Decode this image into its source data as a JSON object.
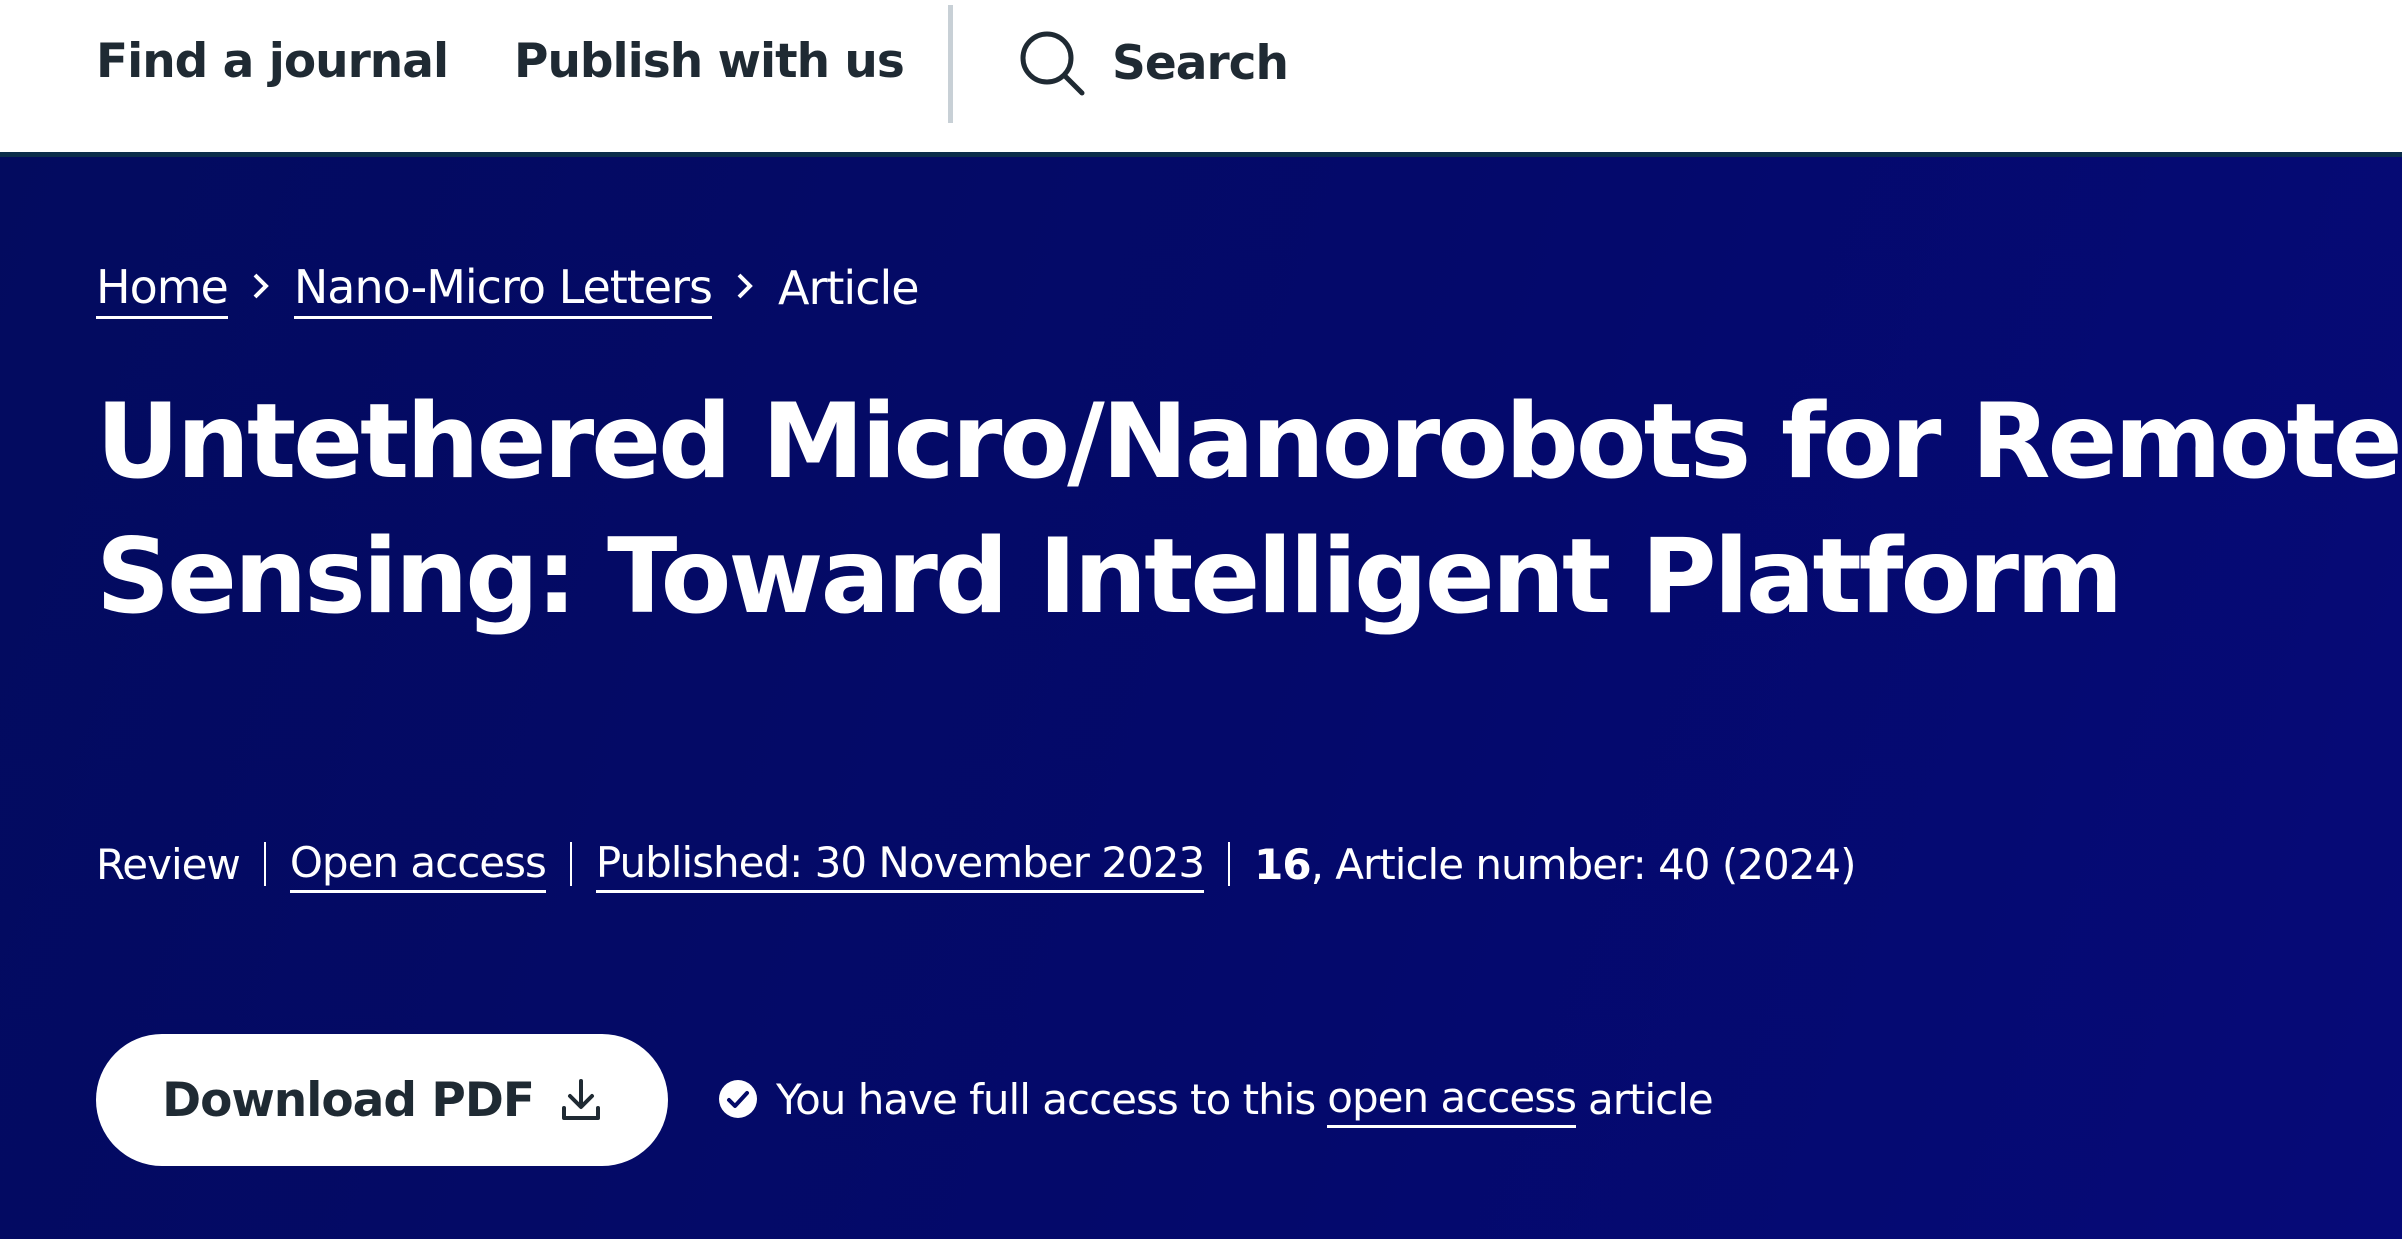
{
  "topnav": {
    "find_journal": "Find a journal",
    "publish": "Publish with us",
    "search": "Search",
    "search_icon": "search-icon"
  },
  "breadcrumb": {
    "items": [
      "Home",
      "Nano-Micro Letters",
      "Article"
    ],
    "separator_icon": "chevron-right-icon"
  },
  "article": {
    "title_line1": "Untethered Micro/Nanorobots for Remote",
    "title_line2": "Sensing: Toward Intelligent Platform",
    "type": "Review",
    "access": "Open access",
    "published": "Published: 30 November 2023",
    "volume": "16",
    "article_number": ", Article number: 40 (2024)"
  },
  "download": {
    "label": "Download PDF",
    "icon": "download-icon"
  },
  "access_note": {
    "icon": "check-circle-icon",
    "prefix": "You have full access to this",
    "link": "open access",
    "suffix": "article"
  },
  "colors": {
    "hero_background": "#040a68",
    "nav_text": "#1f2a33",
    "nav_border": "#0b2d4a",
    "divider": "#c8d0d6"
  }
}
